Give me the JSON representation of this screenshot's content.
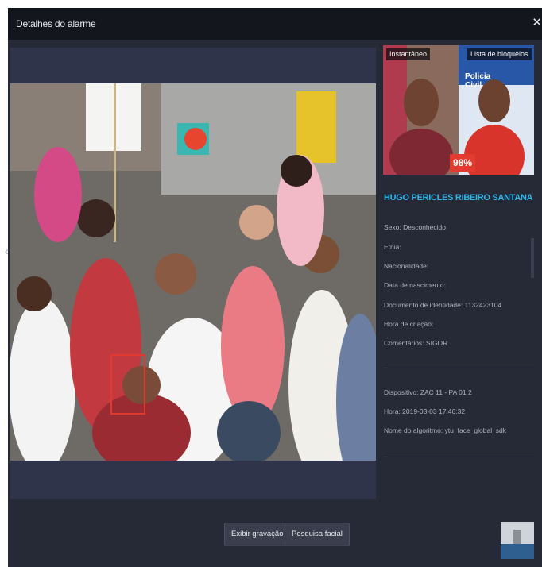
{
  "dialog": {
    "title": "Detalhes do alarme",
    "close_glyph": "✕"
  },
  "thumbnails": {
    "snapshot_label": "Instantâneo",
    "blocklist_label": "Lista de bloqueios",
    "match_score": "98%",
    "blocklist_overlay_text": "Policia Civil"
  },
  "person": {
    "name": "HUGO PERICLES RIBEIRO SANTANA",
    "fields": [
      "Sexo: Desconhecido",
      "Etnia:",
      "Nacionalidade:",
      "Data de nascimento:",
      "Documento de identidade: 1132423104",
      "Hora de criação:",
      "Comentários: SIGOR"
    ]
  },
  "event": {
    "fields": [
      "Dispositivo: ZAC 11 - PA 01 2",
      "Hora: 2019-03-03 17:46:32",
      "Nome do algoritmo: ytu_face_global_sdk"
    ]
  },
  "buttons": {
    "show_recording": "Exibir gravação",
    "facial_search": "Pesquisa facial"
  },
  "colors": {
    "dialog_bg": "#262a36",
    "titlebar_bg": "#14161d",
    "accent_name": "#33b4e8",
    "detection_box": "#e0392f",
    "score_badge": "#e23b2f"
  },
  "icons": {
    "close": "close-icon",
    "prev": "chevron-left-icon"
  }
}
